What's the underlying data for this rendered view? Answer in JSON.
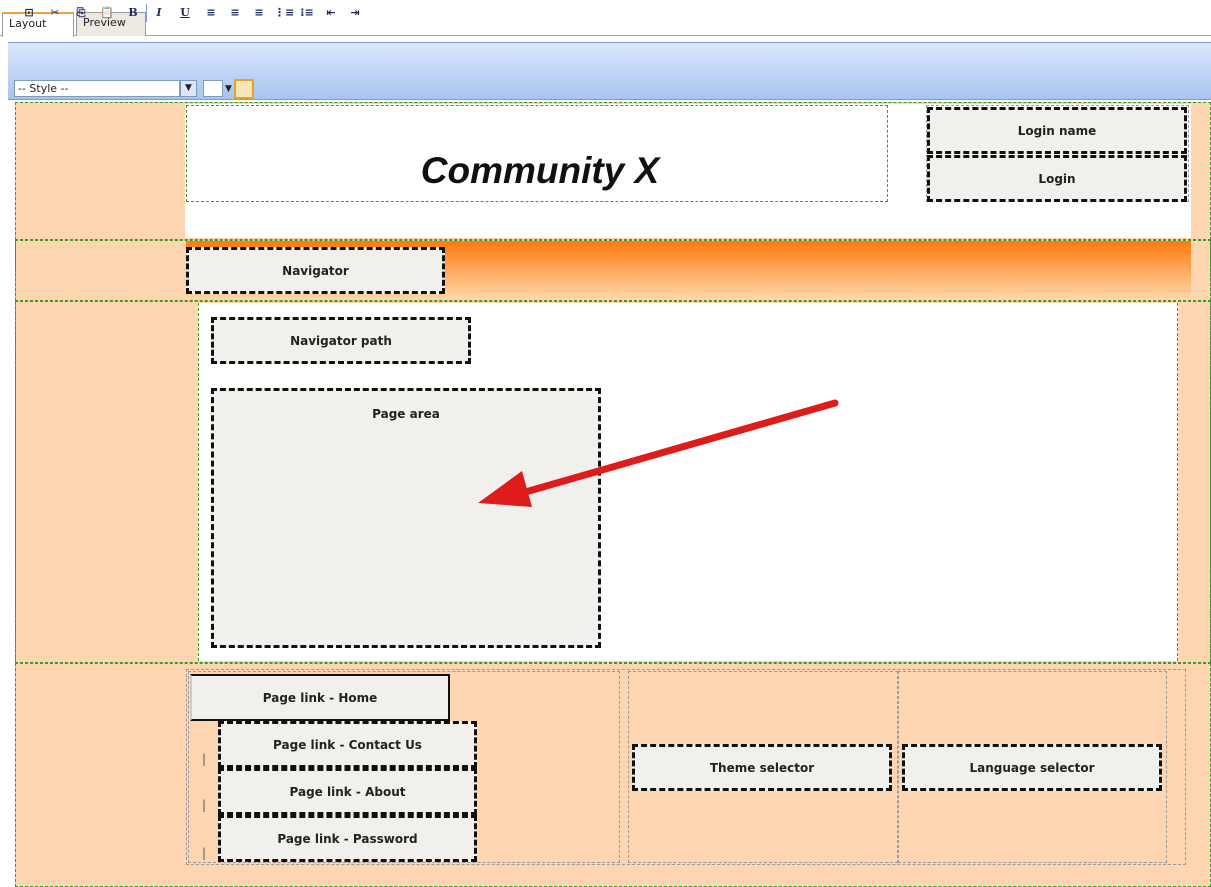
{
  "tabs": [
    {
      "label": "Layout"
    },
    {
      "label": "Preview"
    }
  ],
  "toolbar": {
    "style_select": "-- Style --",
    "buttons": [
      "source-icon",
      "cut-icon",
      "copy-icon",
      "paste-icon",
      "B",
      "I",
      "U",
      "align-left-icon",
      "align-center-icon",
      "align-right-icon",
      "ordered-list-icon",
      "unordered-list-icon",
      "outdent-icon",
      "indent-icon"
    ]
  },
  "header": {
    "title": "Community X"
  },
  "webparts": {
    "login_name": "Login name",
    "login": "Login",
    "navigator": "Navigator",
    "navigator_path": "Navigator path",
    "page_area": "Page area",
    "link_home": "Page link - Home",
    "link_contact": "Page link - Contact Us",
    "link_about": "Page link - About",
    "link_password": "Page link - Password",
    "theme_selector": "Theme selector",
    "language_selector": "Language selector"
  },
  "separators": [
    "|",
    "|",
    "|"
  ],
  "colors": {
    "peach": "#fdd5b0",
    "orange": "#ff7a0e",
    "webpart_bg": "#f1f0ec",
    "arrow": "#e01b1b"
  }
}
